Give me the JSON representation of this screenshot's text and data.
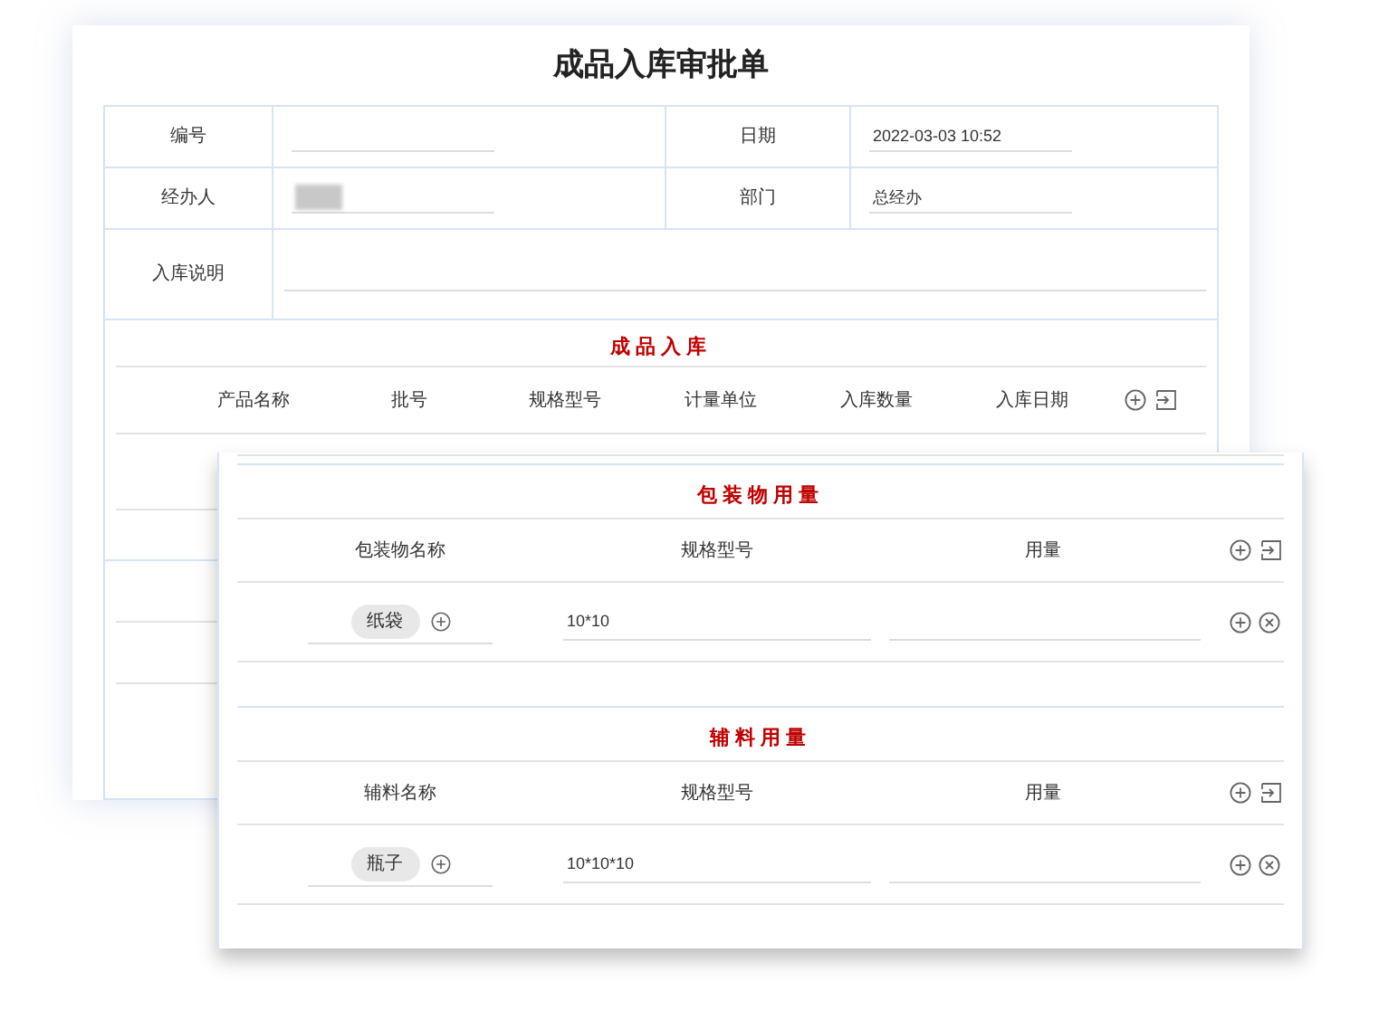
{
  "title": "成品入库审批单",
  "fields": [
    {
      "label": "编号"
    },
    {
      "label": "日期",
      "value": "2022-03-03 10:52"
    },
    {
      "label": "经办人",
      "redacted": true
    },
    {
      "label": "部门",
      "value": "总经办"
    },
    {
      "label": "入库说明",
      "wide": true
    }
  ],
  "product_section": {
    "title": "成品入库",
    "columns": [
      "产品名称",
      "批号",
      "规格型号",
      "计量单位",
      "入库数量",
      "入库日期"
    ]
  },
  "sub_sections": [
    {
      "title": "包装物用量",
      "columns": [
        "包装物名称",
        "规格型号",
        "用量"
      ],
      "rows": [
        {
          "name": "纸袋",
          "spec": "10*10"
        }
      ]
    },
    {
      "title": "辅料用量",
      "columns": [
        "辅料名称",
        "规格型号",
        "用量"
      ],
      "rows": [
        {
          "name": "瓶子",
          "spec": "10*10*10"
        }
      ]
    }
  ]
}
